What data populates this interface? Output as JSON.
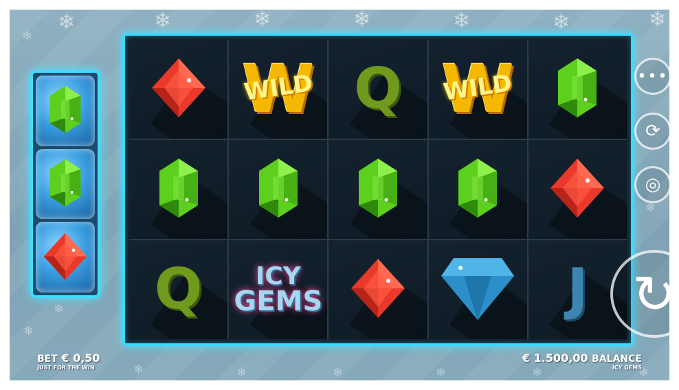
{
  "game": {
    "logo_line1": "ICY",
    "logo_line2": "GEMS",
    "wild_label": "WILD",
    "wild_letter": "W"
  },
  "grid": [
    [
      "red-gem",
      "wild",
      "Q",
      "wild",
      "green-gem"
    ],
    [
      "green-gem",
      "green-gem",
      "green-gem",
      "green-gem",
      "red-gem"
    ],
    [
      "Q",
      "icy-gems",
      "red-gem",
      "blue-diamond",
      "J"
    ]
  ],
  "side_reel": [
    "green-gem",
    "green-gem",
    "red-gem"
  ],
  "footer": {
    "bet_label": "BET",
    "bet_value": "€ 0,50",
    "provider": "JUST FOR THE WIN",
    "balance_value": "€ 1.500,00",
    "balance_label": "BALANCE",
    "game_name": "ICY GEMS"
  },
  "controls": {
    "menu_icon": "ellipsis-icon",
    "autoplay_icon": "autoplay-icon",
    "bet_icon": "chip-icon",
    "spin_icon": "spin-arrow-icon"
  },
  "colors": {
    "frame_glow": "#3fd8ff",
    "reel_bg": "#0d1b27",
    "red_gem": "#e8392a",
    "green_gem": "#5ccf1f",
    "blue_diamond": "#2b8fc9",
    "wild_gold": "#f4b800",
    "letter_green": "#6f9a1e",
    "letter_blue": "#3d84b0"
  }
}
